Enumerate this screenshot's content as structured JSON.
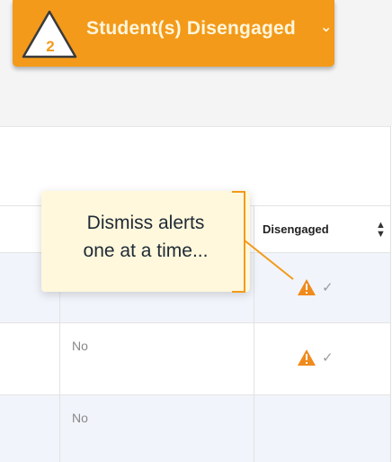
{
  "alert": {
    "count": "2",
    "label": "Student(s) Disengaged",
    "chevron": "⌄",
    "color": "#f39a1a"
  },
  "table": {
    "column_header": "Disengaged",
    "sort_icon": "sort-both-icon",
    "rows": [
      {
        "value": "",
        "status": "warning-check"
      },
      {
        "value": "No",
        "status": "warning-check"
      },
      {
        "value": "No",
        "status": ""
      }
    ]
  },
  "callout": {
    "line1": "Dismiss alerts",
    "line2": "one at a time..."
  },
  "colors": {
    "warning": "#f08a1c",
    "callout_bg": "#fff8dc",
    "callout_line": "#f39a1a"
  }
}
